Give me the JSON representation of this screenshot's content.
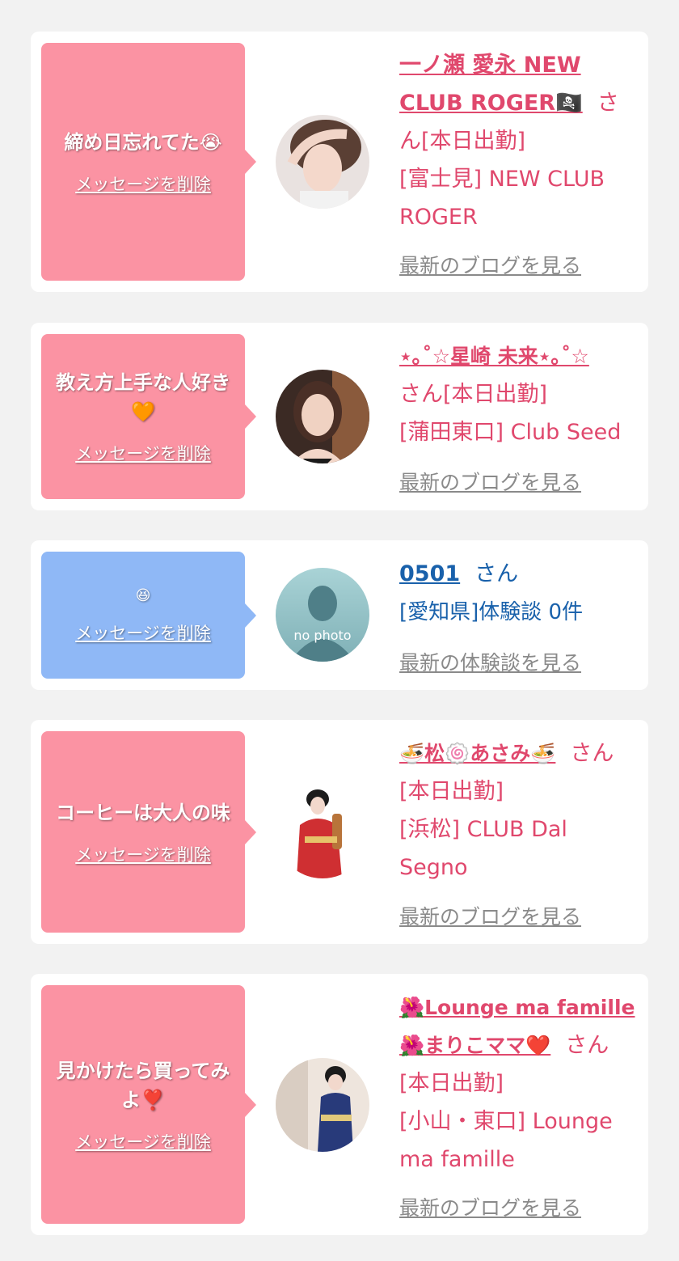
{
  "cards": [
    {
      "message": "締め日忘れてた😭",
      "delete_label": "メッセージを削除",
      "name": "一ノ瀬 愛永 NEW CLUB ROGER🏴‍☠️",
      "honorific": "さん",
      "status": "[本日出勤]",
      "shop": "[富士見] NEW CLUB ROGER",
      "link": "最新のブログを見る"
    },
    {
      "message": "教え方上手な人好き🧡",
      "delete_label": "メッセージを削除",
      "name": "⋆｡˚☆星崎 未来⋆｡˚☆",
      "honorific": "さん",
      "status": "[本日出勤]",
      "shop": "[蒲田東口] Club Seed",
      "link": "最新のブログを見る"
    },
    {
      "message": "😆",
      "delete_label": "メッセージを削除",
      "name": "0501",
      "honorific": "さん",
      "shop": "[愛知県]体験談 0件",
      "photo_text": "no photo",
      "link": "最新の体験談を見る"
    },
    {
      "message": "コーヒーは大人の味",
      "delete_label": "メッセージを削除",
      "name": "🍜松🍥あさみ🍜",
      "honorific": "さん",
      "status": "[本日出勤]",
      "shop": "[浜松] CLUB Dal Segno",
      "link": "最新のブログを見る"
    },
    {
      "message": "見かけたら買ってみよ❣️",
      "delete_label": "メッセージを削除",
      "name": "🌺Lounge ma famille 🌺まりこママ❤️",
      "honorific": "さん",
      "status": "[本日出勤]",
      "shop": "[小山・東口] Lounge ma famille",
      "link": "最新のブログを見る"
    }
  ],
  "colors": {
    "pink_bubble": "#fb93a3",
    "blue_bubble": "#8fb8f6",
    "pink_text": "#e0486d",
    "blue_text": "#1961ab"
  }
}
